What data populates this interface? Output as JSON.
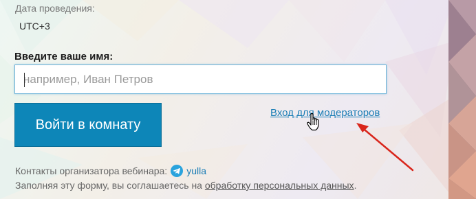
{
  "event": {
    "date_label": "Дата проведения:",
    "timezone": "UTC+3"
  },
  "form": {
    "name_label": "Введите ваше имя:",
    "name_placeholder": "например, Иван Петров",
    "name_value": "",
    "enter_button_label": "Войти в комнату",
    "moderator_link_label": "Вход для модераторов"
  },
  "footer": {
    "contacts_label": "Контакты организатора вебинара:",
    "contact_icon": "telegram-icon",
    "contact_user": "yulla",
    "consent_text": "Заполняя эту форму, вы соглашаетесь на ",
    "consent_link_label": "обработку персональных данных",
    "consent_tail": "."
  },
  "colors": {
    "accent": "#0d86b8",
    "link": "#1a7db5",
    "arrow": "#d9261c"
  }
}
